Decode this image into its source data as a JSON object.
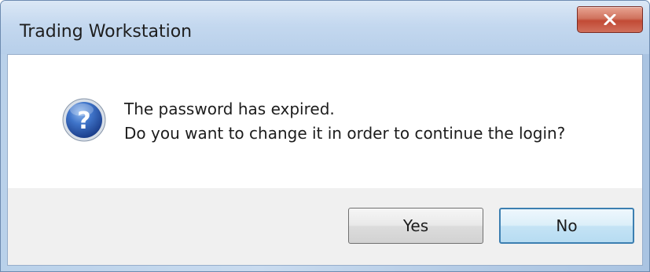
{
  "window": {
    "title": "Trading Workstation",
    "close_icon": "close-icon"
  },
  "message": {
    "icon": "question-icon",
    "line1": "The password has expired.",
    "line2": "Do you want to change it in order to continue the login?"
  },
  "buttons": {
    "yes_label": "Yes",
    "no_label": "No",
    "default": "No"
  },
  "colors": {
    "titlebar": "#c4d8ef",
    "close_button": "#c24a35",
    "icon_blue": "#2a5db0",
    "default_button_border": "#3c7fb1",
    "button_area": "#f0f0f0"
  }
}
